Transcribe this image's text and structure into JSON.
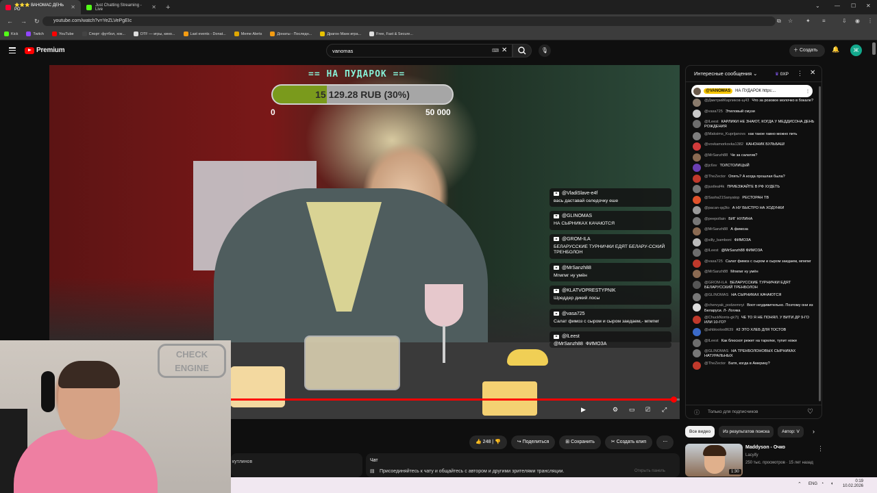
{
  "browser": {
    "tabs": [
      {
        "label": "⭐⭐⭐ ВАНОМАС ДЕНЬ РО",
        "active": true
      },
      {
        "label": "Just Chatting Streaming - Live",
        "active": false
      }
    ],
    "url": "youtube.com/watch?v=YeZLVePgEIc",
    "bookmarks": [
      "Kick",
      "Twitch",
      "YouTube",
      "Спорт: футбол, хок...",
      "DTF — игры, кино...",
      "Last events - Donat...",
      "Meme Alerts",
      "Донаты - Последн...",
      "Драгон Манк игра...",
      "Free, Fast & Secure..."
    ]
  },
  "youtube": {
    "logo": "Premium",
    "search_value": "vanomas",
    "create_label": "Создать",
    "avatar_letter": "Ж"
  },
  "overlay": {
    "donation_title": "== НА ПУДАРОК ==",
    "donation_amount": "15 129.28 RUB (30%)",
    "donation_progress": 0.3,
    "donation_min": "0",
    "donation_max": "50 000",
    "chat": [
      {
        "user": "@VladiSlave-e4f",
        "text": "вась даставай селедочку еше"
      },
      {
        "user": "@GLINOMAS",
        "text": "НА СЫРНИКАХ КАЧАЮТСЯ"
      },
      {
        "user": "@GROM-ILA",
        "text": "БЕЛАРУССКИЕ ТУРНИЧКИ ЕДЯТ БЕЛАРУ-ССКИЙ ТРЕНБОЛОН"
      },
      {
        "user": "@MrSanzh88",
        "text": "Мгмгмг ну умён"
      },
      {
        "user": "@KLATVOPRESTYPNIK",
        "text": "Шреддер дикий лосы"
      },
      {
        "user": "@vasa725",
        "text": "Салат фимоз с сыром и сыром заедаем,- мгмгмг"
      },
      {
        "user": "@lLeest",
        "text": ""
      },
      {
        "user": "@MrSanzh88",
        "text": "ФИМОЗА"
      }
    ],
    "progress": 0.99
  },
  "webcam": {
    "sign_text": "CHECK ENGINE"
  },
  "actions": {
    "likes": "248",
    "share": "Поделиться",
    "save": "Сохранить",
    "clip": "Создать клип"
  },
  "chat_strip": {
    "left_text": "кутлинов",
    "title": "Чат",
    "join_text": "Присоединяйтесь к чату и общайтесь с автором и другими зрителями трансляции.",
    "open_label": "Открыть панель"
  },
  "livechat": {
    "title": "Интересные сообщения",
    "xp": "0XP",
    "pinned_user": "@VANOMAS",
    "pinned_text": "НА ПУДАРОК https:...",
    "footer": "Только для подписчиков",
    "messages": [
      {
        "user": "@ДмитрийКарликов-щ43",
        "text": "Что за розовое молочко в бокале?",
        "color": "#8a7b6c"
      },
      {
        "user": "@vasa725",
        "text": "Этиловый смузи",
        "color": "#c9c9c9"
      },
      {
        "user": "@lLeest",
        "text": "КАРЛИКИ НЕ ЗНАЮТ, КОГДА У МЕДДИСОНА ДЕНЬ РОЖДЕНИЯ",
        "color": "#6d6d6d"
      },
      {
        "user": "@Maksims_Kupriјanovs",
        "text": "как такое гавно можно пить",
        "color": "#7e7e7e"
      },
      {
        "user": "@vovkamorkovka1382",
        "text": "КАНОНИК БУЛЬБАШ!",
        "color": "#d13b3b"
      },
      {
        "user": "@MrSanzh88",
        "text": "Че за салатик?",
        "color": "#8a6a52"
      },
      {
        "user": "@jc6sv",
        "text": "ТОЛСТОЛИЦЫЙ",
        "color": "#6b3fb3"
      },
      {
        "user": "@TheZector",
        "text": "Опять? А когда прошлая была?",
        "color": "#c0392b"
      },
      {
        "user": "@justleaf4k",
        "text": "ПРИЕЗЖАЙТЕ В РФ ХУДЕТЬ",
        "color": "#777"
      },
      {
        "user": "@Sasha21Sanyatop",
        "text": "РЕСТОРАН ТВ",
        "color": "#e0522b"
      },
      {
        "user": "@pacan-qq3to",
        "text": "А НУ БЫСТРО НА ХОДУНКИ",
        "color": "#9a9a9a"
      },
      {
        "user": "@peepollain",
        "text": "БИГ НУЛИНА",
        "color": "#777"
      },
      {
        "user": "@MrSanzh88",
        "text": "А фимоза",
        "color": "#8a6a52"
      },
      {
        "user": "@silly_bamboni",
        "text": "ФИМОЗА",
        "color": "#bbb"
      },
      {
        "user": "@lLeest",
        "text": "@MrSanzh88 ФИМОЗА",
        "color": "#6d6d6d"
      },
      {
        "user": "@vasa725",
        "text": "Салат фимоз с сыром и сыром заедаем, мгмгмг",
        "color": "#c0392b"
      },
      {
        "user": "@MrSanzh88",
        "text": "Мгмгмг ну умён",
        "color": "#8a6a52"
      },
      {
        "user": "@GROM-ILA",
        "text": "БЕЛАРУССКИЕ ТУРНИЧКИ ЕДЯТ БЕЛАРУССКИЙ ТРЕНБОЛОН",
        "color": "#555"
      },
      {
        "user": "@GLINOMAS",
        "text": "НА СЫРНИКАХ КАЧАЮТСЯ",
        "color": "#777"
      },
      {
        "user": "@chervyak_podzemnyi",
        "text": "Воот неудивительно. Поэтому они из Беларуси. Л- Логика",
        "color": "#ddd"
      },
      {
        "user": "@ChuckNorris-gk7lj",
        "text": "ЧЕ ТО Я НЕ ПОНЯЛ. У ВИТИ ДР 9-ГО ИЛИ 10-ГО?",
        "color": "#c0392b"
      },
      {
        "user": "@ahbloolоo8639",
        "text": "#2 ЭТО ХЛЕБ ДЛЯ ТОСТОВ",
        "color": "#3b6ac9"
      },
      {
        "user": "@lLeest",
        "text": "Как блюскот режет на тарелке, тупит ножи",
        "color": "#6d6d6d"
      },
      {
        "user": "@GLINOMAS",
        "text": "НА ТРЕНБОЛОНОВЫХ СЫРНИКАХ НАТУРАЛЬНЫХ",
        "color": "#777"
      },
      {
        "user": "@TheZector",
        "text": "Батя, когда в Америку?",
        "color": "#c0392b"
      }
    ]
  },
  "recommendations": {
    "chips": [
      "Все видео",
      "Из результатов поиска",
      "Автор: V"
    ],
    "video": {
      "title": "Maddyson - Очко",
      "channel": "Lacyify",
      "meta": "250 тыс. просмотров · 15 лет назад",
      "duration": "1:30"
    }
  },
  "taskbar": {
    "lang": "ENG",
    "time": "0:19",
    "date": "10.02.2026"
  },
  "colors": {
    "accent_red": "#ff0000",
    "bg": "#0f0f0f"
  }
}
